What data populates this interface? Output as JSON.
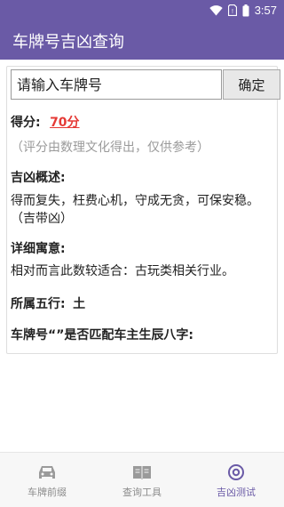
{
  "status_bar": {
    "time": "3:57"
  },
  "app_bar": {
    "title": "车牌号吉凶查询"
  },
  "search": {
    "placeholder": "请输入车牌号",
    "confirm_label": "确定"
  },
  "score": {
    "label": "得分:",
    "value": "70分",
    "note": "（评分由数理文化得出，仅供参考）"
  },
  "fortune": {
    "title": "吉凶概述:",
    "text": "得而复失，枉费心机，守成无贪，可保安稳。（吉带凶）"
  },
  "meaning": {
    "title": "详细寓意:",
    "text": "相对而言此数较适合：古玩类相关行业。"
  },
  "element": {
    "label": "所属五行:",
    "value": "土"
  },
  "match": {
    "label": "车牌号“”是否匹配车主生辰八字:"
  },
  "bottom_nav": [
    {
      "label": "车牌前缀",
      "icon": "car-icon"
    },
    {
      "label": "查询工具",
      "icon": "book-icon"
    },
    {
      "label": "吉凶测试",
      "icon": "compass-icon",
      "active": true
    }
  ],
  "colors": {
    "primary": "#6a5aa6",
    "score": "#e53935"
  }
}
